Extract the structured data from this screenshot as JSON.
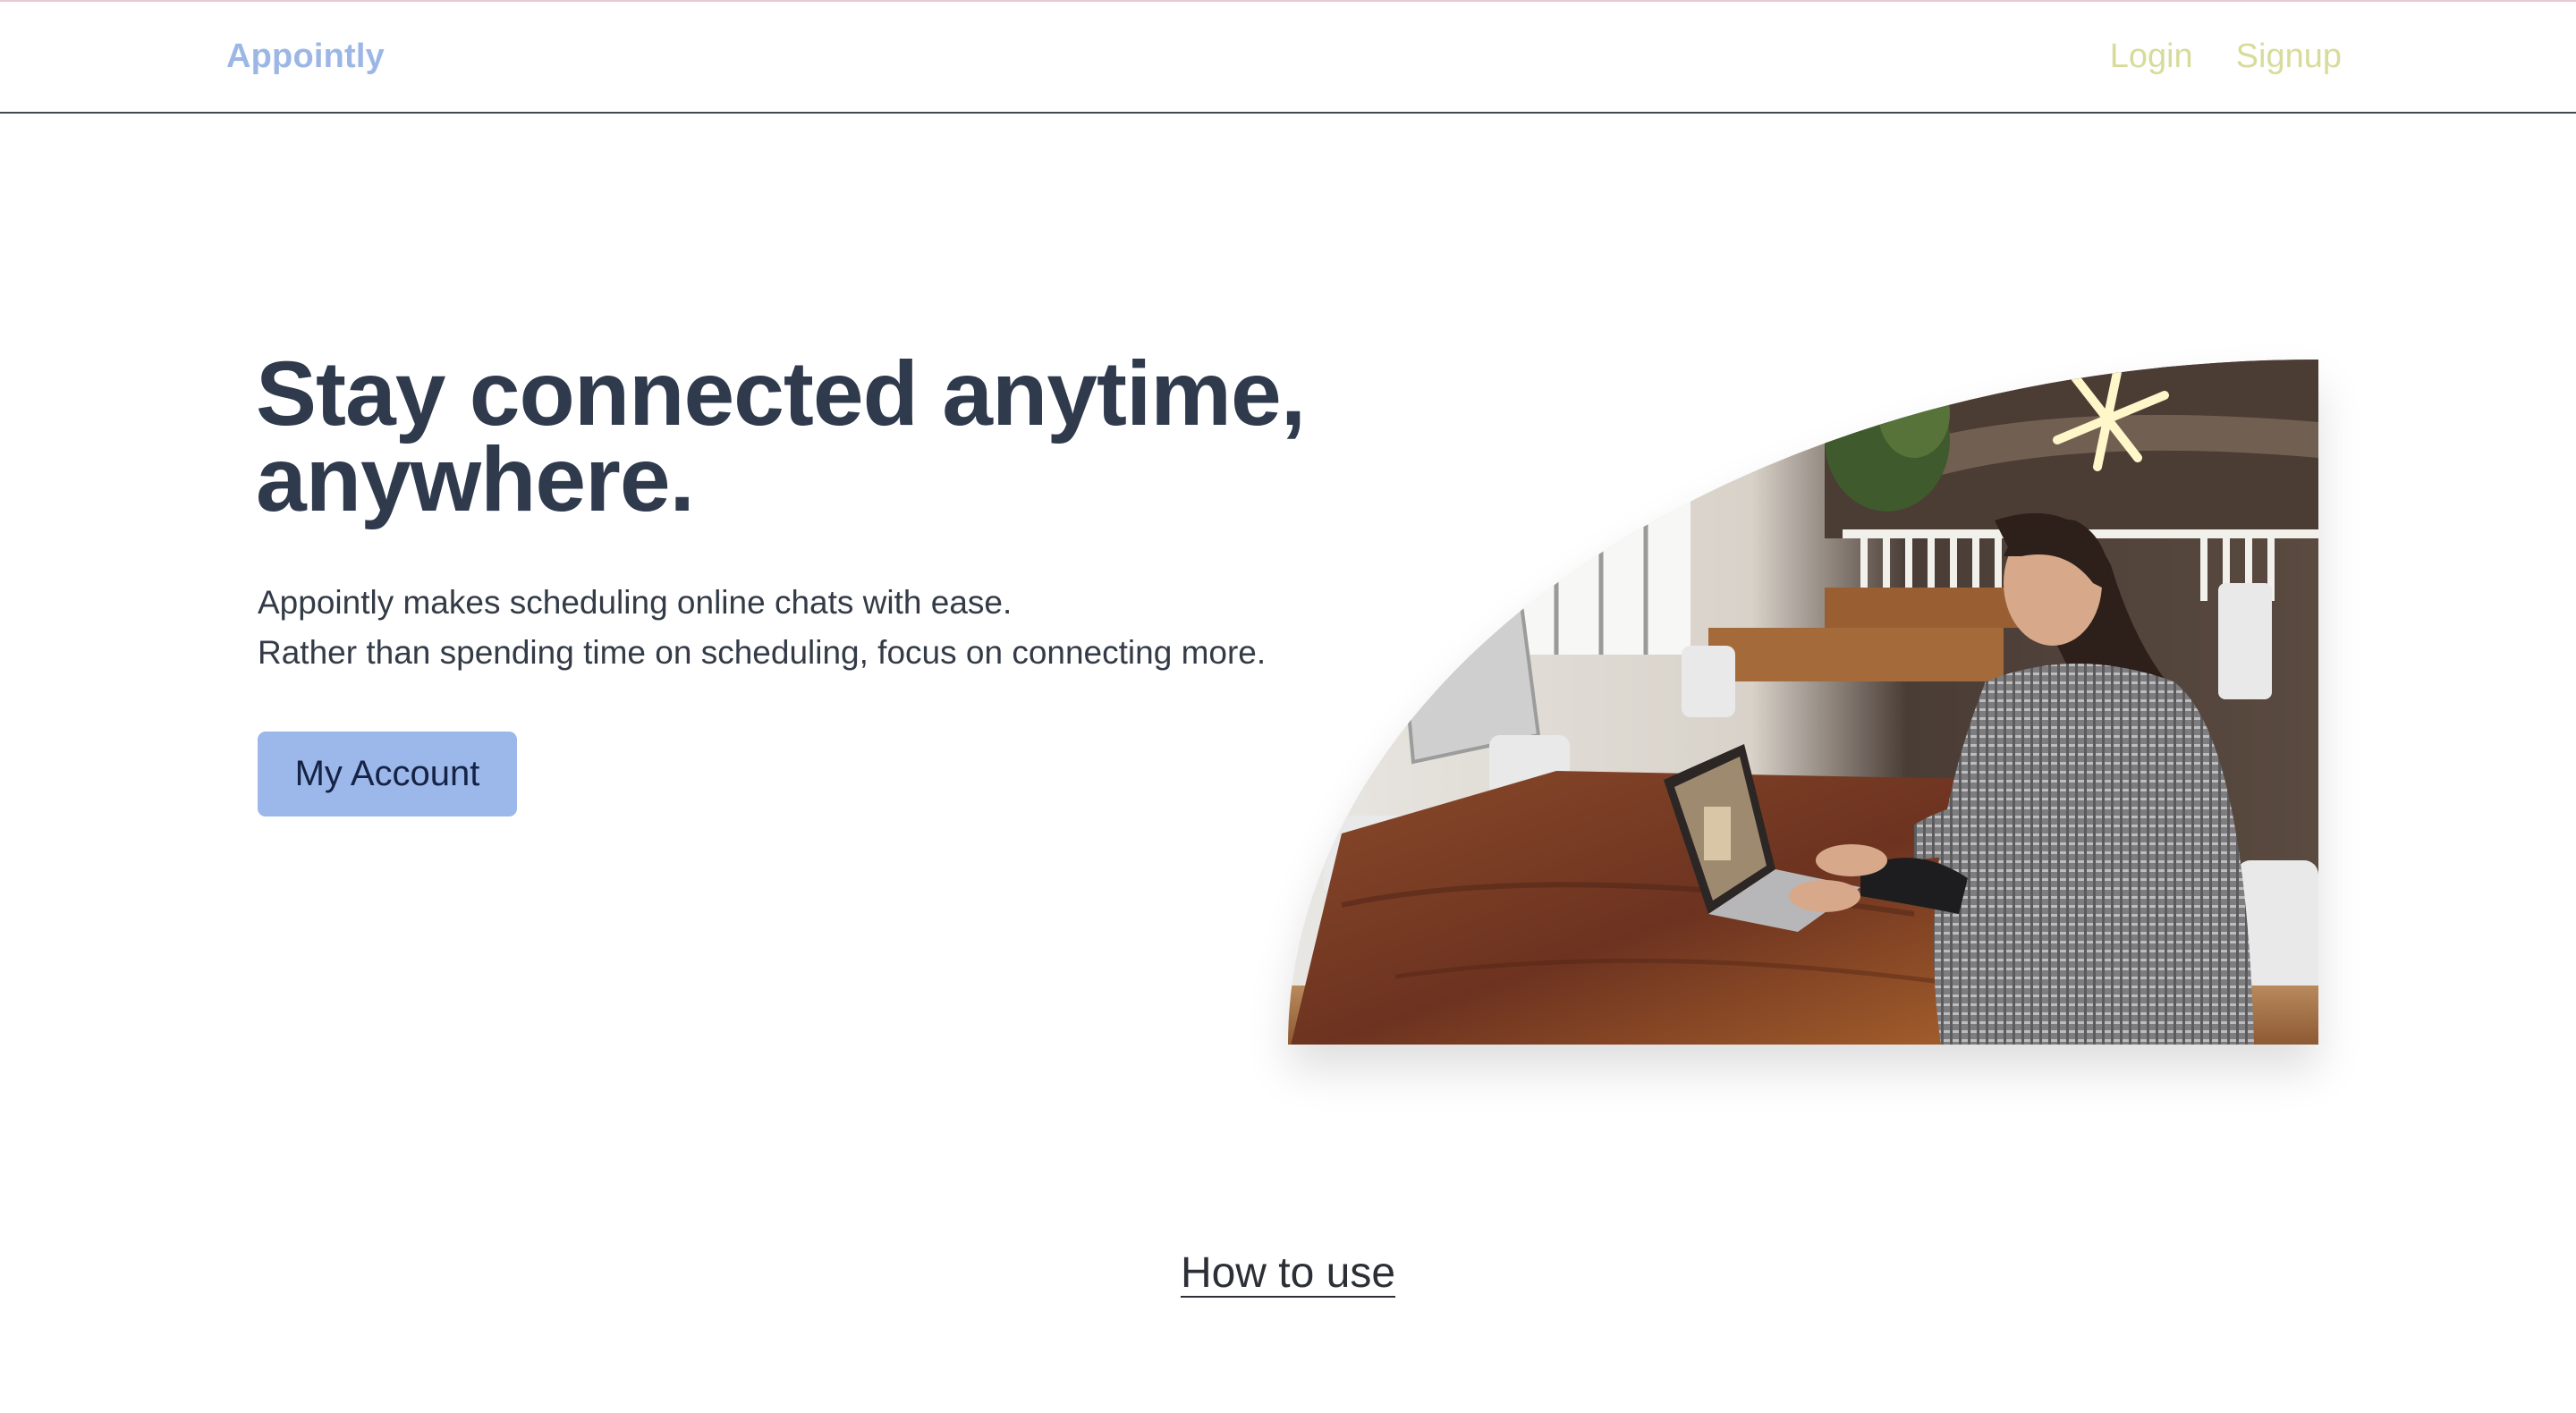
{
  "navbar": {
    "brand": "Appointly",
    "login_label": "Login",
    "signup_label": "Signup"
  },
  "hero": {
    "title": "Stay connected anytime, anywhere.",
    "subtitle_line1": "Appointly makes scheduling online chats with ease.",
    "subtitle_line2": "Rather than spending time on scheduling, focus on connecting more.",
    "cta_label": "My Account",
    "image_alt": "Woman on a video call at a laptop on a wooden table"
  },
  "section": {
    "how_to_use": "How to use"
  },
  "colors": {
    "brand": "#9cb7e6",
    "nav_link": "#d7dc9a",
    "heading": "#2f3a4d",
    "cta_bg": "#9cb7ea",
    "cta_text": "#152344"
  }
}
